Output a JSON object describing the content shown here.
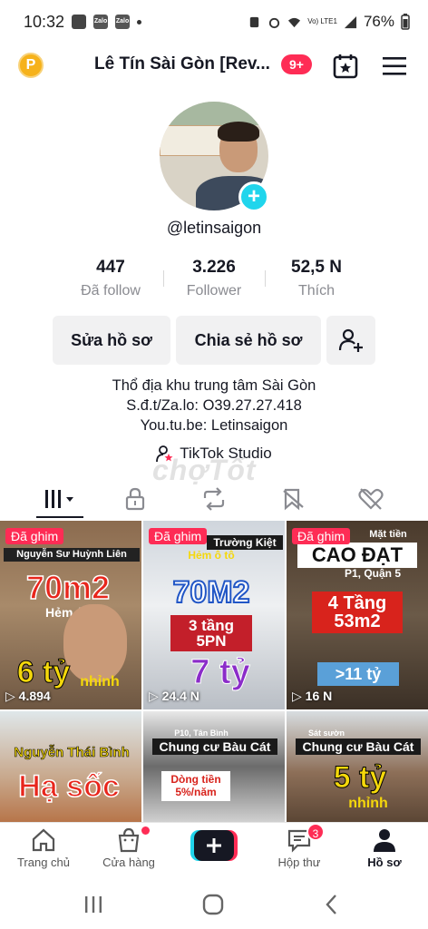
{
  "status_bar": {
    "time": "10:32",
    "notification_icons": [
      "Zalo",
      "Zalo"
    ],
    "network_label": "Vo) LTE1",
    "battery": "76%"
  },
  "header": {
    "title": "Lê Tín Sài Gòn [Rev...",
    "badge": "9+",
    "coin_letter": "P"
  },
  "profile": {
    "username": "@letinsaigon",
    "stats": [
      {
        "value": "447",
        "label": "Đã follow"
      },
      {
        "value": "3.226",
        "label": "Follower"
      },
      {
        "value": "52,5 N",
        "label": "Thích"
      }
    ],
    "buttons": {
      "edit": "Sửa hồ sơ",
      "share": "Chia sẻ hồ sơ"
    },
    "bio_lines": [
      "Thổ địa khu trung tâm Sài Gòn",
      "S.đ.t/Za.lo: O39.27.27.418",
      "You.tu.be: Letinsaigon"
    ],
    "studio_link": "TikTok Studio",
    "watermark": "chợTốt"
  },
  "videos": [
    {
      "pinned": "Đã ghim",
      "views": "4.894",
      "headline": "70m2",
      "subline": "Hẻm ô tô",
      "top_text": "Nguyễn Sư Huỳnh Liên",
      "price": "6 tỷ",
      "extra": "nhỉnh"
    },
    {
      "pinned": "Đã ghim",
      "views": "24.4 N",
      "headline": "70M2",
      "subline": "Hẻm ô tô",
      "top_text": "Trường Kiệt",
      "price": "7 tỷ",
      "extra": "3 tầng 5PN"
    },
    {
      "pinned": "Đã ghim",
      "views": "16 N",
      "headline": "CAO ĐẠT",
      "subline": "P1, Quận 5",
      "top_text": "Mặt tiền",
      "price": ">11 tỷ",
      "extra": "4 Tầng 53m2"
    },
    {
      "pinned": "",
      "views": "",
      "headline": "Hạ sốc",
      "subline": "",
      "top_text": "Nguyễn Thái Bình",
      "price": "",
      "extra": ""
    },
    {
      "pinned": "",
      "views": "",
      "headline": "Chung cư Bàu Cát",
      "subline": "Dòng tiền 5%/năm",
      "top_text": "P10, Tân Bình",
      "price": "",
      "extra": ""
    },
    {
      "pinned": "",
      "views": "",
      "headline": "Chung cư Bàu Cát",
      "subline": "",
      "top_text": "Sát sườn",
      "price": "5 tỷ",
      "extra": "nhỉnh"
    }
  ],
  "bottom_nav": {
    "home": "Trang chủ",
    "shop": "Cửa hàng",
    "create": "+",
    "inbox": "Hộp thư",
    "inbox_badge": "3",
    "profile": "Hồ sơ"
  },
  "colors": {
    "accent": "#fe2c55",
    "avatar_add": "#20d5ec",
    "coin": "#f6b21b"
  }
}
